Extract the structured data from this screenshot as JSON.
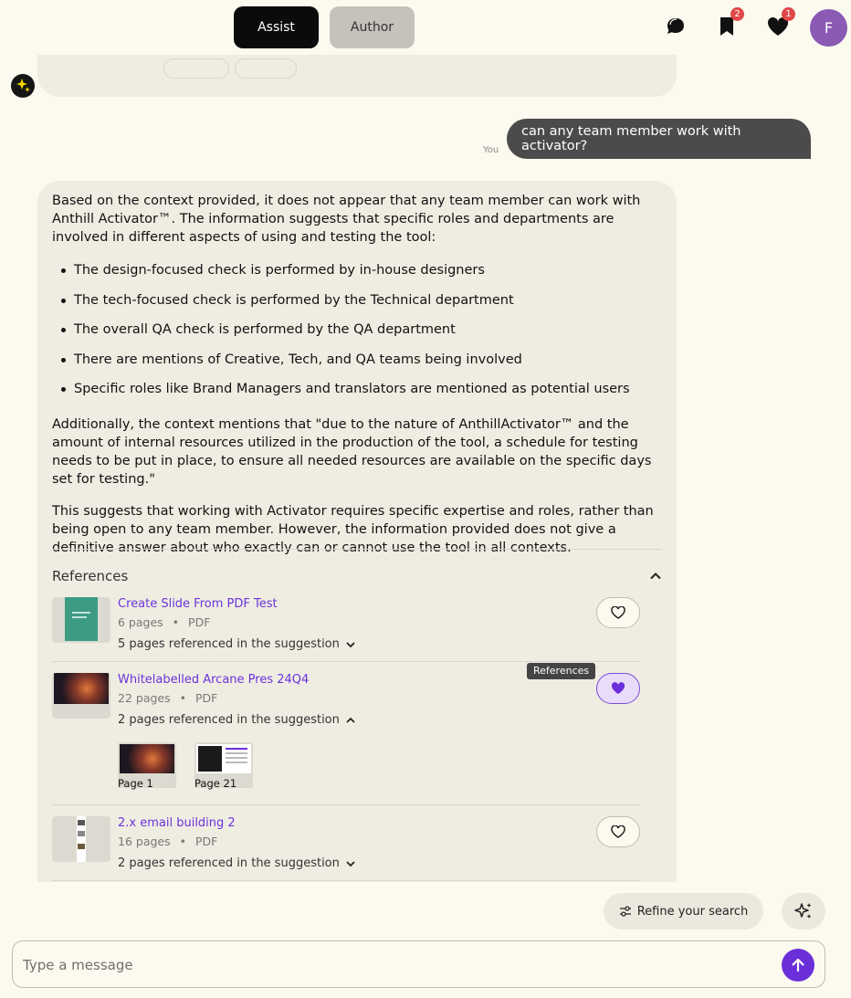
{
  "header": {
    "assist_label": "Assist",
    "author_label": "Author",
    "bookmarks_count": "2",
    "favorites_count": "1",
    "avatar_initial": "F"
  },
  "conversation": {
    "you_label": "You",
    "user_message": "can any team member work with activator?",
    "answer": {
      "intro": "Based on the context provided, it does not appear that any team member can work with Anthill Activator™. The information suggests that specific roles and departments are involved in different aspects of using and testing the tool:",
      "bullets": [
        "The design-focused check is performed by in-house designers",
        "The tech-focused check is performed by the Technical department",
        "The overall QA check is performed by the QA department",
        "There are mentions of Creative, Tech, and QA teams being involved",
        "Specific roles like Brand Managers and translators are mentioned as potential users"
      ],
      "para2": "Additionally, the context mentions that \"due to the nature of AnthillActivator™ and the amount of internal resources utilized in the production of the tool, a schedule for testing needs to be put in place, to ensure all needed resources are available on the specific days set for testing.\"",
      "para3": "This suggests that working with Activator requires specific expertise and roles, rather than being open to any team member. However, the information provided does not give a definitive answer about who exactly can or cannot use the tool in all contexts."
    },
    "references": {
      "heading": "References",
      "tooltip": "References",
      "items": [
        {
          "title": "Create Slide From PDF Test",
          "pages": "6 pages",
          "type": "PDF",
          "referenced": "5 pages referenced in the suggestion"
        },
        {
          "title": "Whitelabelled Arcane Pres 24Q4",
          "pages": "22 pages",
          "type": "PDF",
          "referenced": "2 pages referenced in the suggestion",
          "page_previews": [
            "Page 1",
            "Page 21"
          ]
        },
        {
          "title": "2.x email building 2",
          "pages": "16 pages",
          "type": "PDF",
          "referenced": "2 pages referenced in the suggestion"
        }
      ]
    }
  },
  "footer": {
    "refine_label": "Refine your search",
    "composer_placeholder": "Type a message"
  },
  "colors": {
    "background": "#fcfaef",
    "accent": "#6a2fd9",
    "link": "#6b33d9",
    "user_bubble": "#4b4b4b"
  }
}
